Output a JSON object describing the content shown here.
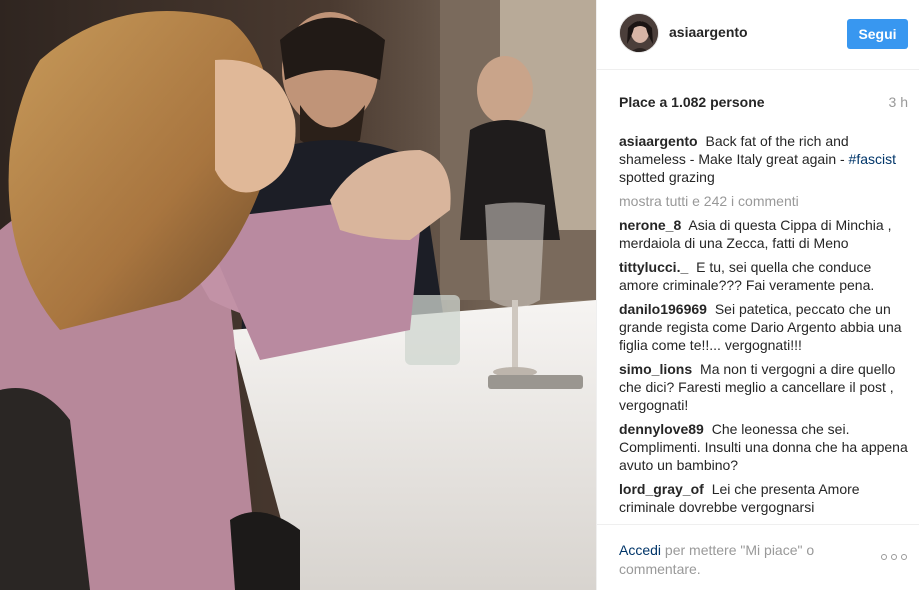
{
  "post": {
    "photo_icon": "photo-image",
    "header": {
      "username": "asiaargento",
      "follow_label": "Segui",
      "follow_color": "#3897f0"
    },
    "likes": "Place a 1.082 persone",
    "age": "3 h",
    "caption": {
      "username": "asiaargento",
      "text_before": "Back fat of the rich and shameless - Make Italy great again -",
      "hashtag": "#fascist",
      "text_after": "spotted grazing"
    },
    "show_all": "mostra tutti e 242 i commenti",
    "comments": [
      {
        "user": "nerone_8",
        "text": "Asia di questa Cippa di Minchia , merdaiola di una Zecca, fatti di Meno"
      },
      {
        "user": "tittylucci._",
        "text": "E tu, sei quella che conduce amore criminale??? Fai veramente pena."
      },
      {
        "user": "danilo196969",
        "text": "Sei patetica, peccato che un grande regista come Dario Argento abbia una figlia come te!!... vergognati!!!"
      },
      {
        "user": "simo_lions",
        "text": "Ma non ti vergogni a dire quello che dici? Faresti meglio a cancellare il post , vergognati!"
      },
      {
        "user": "dennylove89",
        "text": "Che leonessa che sei. Complimenti. Insulti una donna che ha appena avuto un bambino?"
      },
      {
        "user": "lord_gray_of",
        "text": "Lei che presenta Amore criminale dovrebbe vergognarsi"
      }
    ],
    "footer": {
      "login_link": "Accedi",
      "login_text": "per mettere \"Mi piace\" o commentare.",
      "more_icon": "more-options-icon"
    },
    "colors": {
      "link": "#003569",
      "muted": "#999999",
      "divider": "#efefef"
    }
  }
}
